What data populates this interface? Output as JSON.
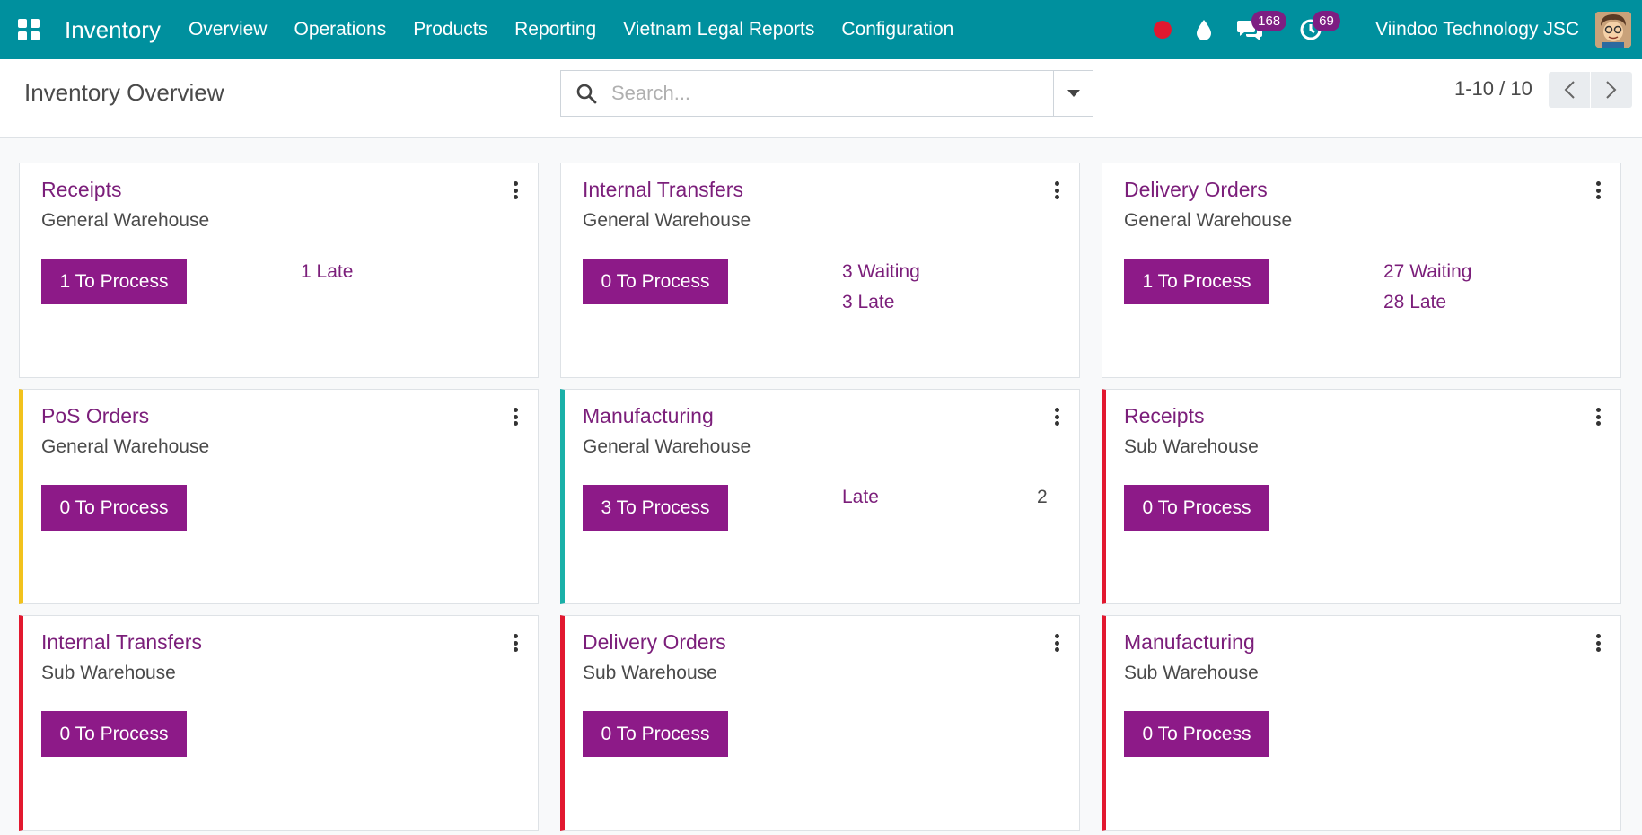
{
  "navbar": {
    "app_name": "Inventory",
    "menu": [
      "Overview",
      "Operations",
      "Products",
      "Reporting",
      "Vietnam Legal Reports",
      "Configuration"
    ],
    "messages_count": "168",
    "activities_count": "69",
    "company": "Viindoo Technology JSC",
    "colors": {
      "navbar": "#00909e",
      "badge": "#7d1e82"
    }
  },
  "control": {
    "title": "Inventory Overview",
    "search_placeholder": "Search...",
    "pager": "1-10 / 10"
  },
  "cards": [
    {
      "title": "Receipts",
      "warehouse": "General Warehouse",
      "button": "1 To Process",
      "stats": [
        {
          "label": "1 Late"
        }
      ]
    },
    {
      "title": "Internal Transfers",
      "warehouse": "General Warehouse",
      "button": "0 To Process",
      "stats": [
        {
          "label": "3 Waiting"
        },
        {
          "label": "3 Late"
        }
      ]
    },
    {
      "title": "Delivery Orders",
      "warehouse": "General Warehouse",
      "button": "1 To Process",
      "stats": [
        {
          "label": "27 Waiting"
        },
        {
          "label": "28 Late"
        }
      ]
    },
    {
      "title": "PoS Orders",
      "warehouse": "General Warehouse",
      "button": "0 To Process",
      "border_color": "#f2c21d"
    },
    {
      "title": "Manufacturing",
      "warehouse": "General Warehouse",
      "button": "3 To Process",
      "border_color": "#1ab0a8",
      "stats": [
        {
          "label": "Late",
          "value": "2"
        }
      ]
    },
    {
      "title": "Receipts",
      "warehouse": "Sub Warehouse",
      "button": "0 To Process",
      "border_color": "#e2182f"
    },
    {
      "title": "Internal Transfers",
      "warehouse": "Sub Warehouse",
      "button": "0 To Process",
      "border_color": "#e2182f"
    },
    {
      "title": "Delivery Orders",
      "warehouse": "Sub Warehouse",
      "button": "0 To Process",
      "border_color": "#e2182f"
    },
    {
      "title": "Manufacturing",
      "warehouse": "Sub Warehouse",
      "button": "0 To Process",
      "border_color": "#e2182f"
    }
  ],
  "colors": {
    "accent": "#8d1a88",
    "link": "#7b1e7a"
  }
}
